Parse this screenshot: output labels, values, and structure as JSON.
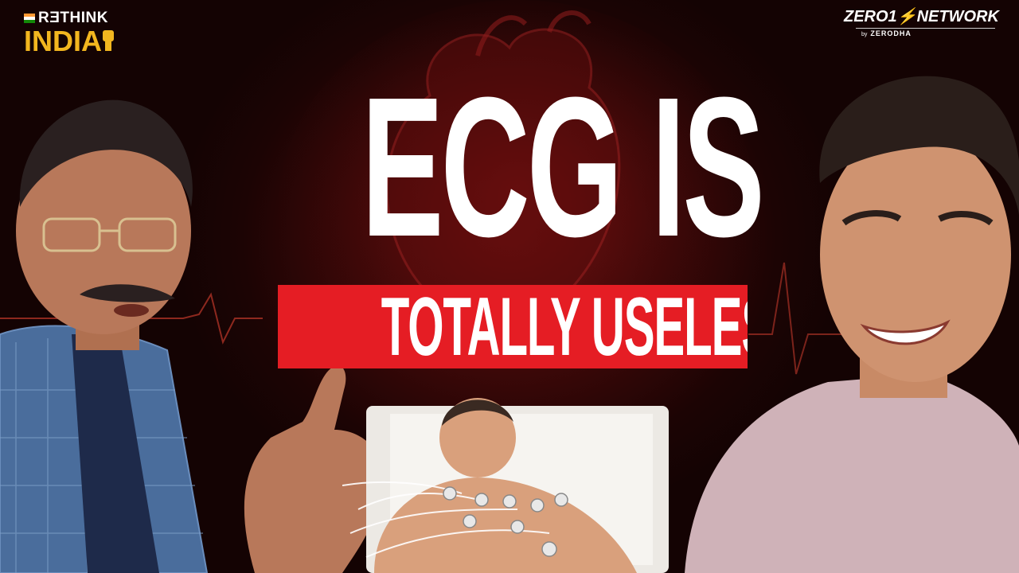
{
  "thumbnail": {
    "headline": "ECG IS",
    "subheadline": "TOTALLY USELESS?",
    "accent_color": "#e51d24",
    "brand_yellow": "#f2b61f"
  },
  "logo_left": {
    "top_text": "RƎTHINK",
    "bottom_text": "INDIA",
    "icon": "fist-icon"
  },
  "logo_right": {
    "title_part1": "ZERO1",
    "title_part2": "NETWORK",
    "sub_by": "by",
    "sub_brand": "ZERODHA"
  }
}
